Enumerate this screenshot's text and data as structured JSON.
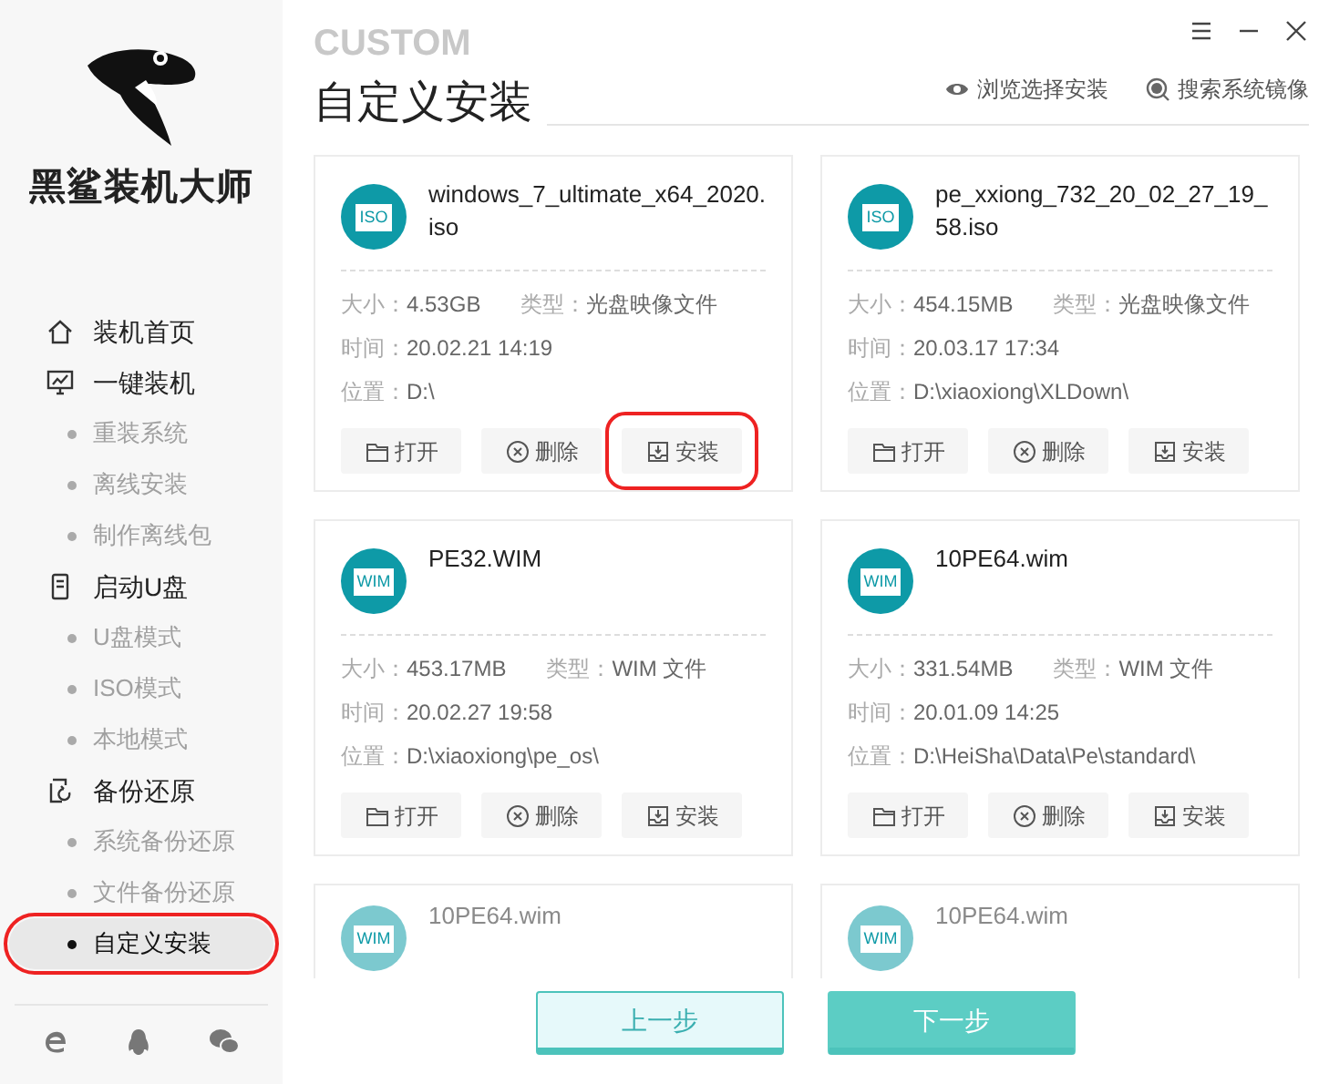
{
  "app": {
    "name": "黑鲨装机大师"
  },
  "nav": [
    {
      "label": "装机首页",
      "kind": "section",
      "selected": false,
      "highlighted": false
    },
    {
      "label": "一键装机",
      "kind": "section",
      "selected": false,
      "highlighted": false
    },
    {
      "label": "重装系统",
      "kind": "sub",
      "selected": false,
      "highlighted": false
    },
    {
      "label": "离线安装",
      "kind": "sub",
      "selected": false,
      "highlighted": false
    },
    {
      "label": "制作离线包",
      "kind": "sub",
      "selected": false,
      "highlighted": false
    },
    {
      "label": "启动U盘",
      "kind": "section",
      "selected": false,
      "highlighted": false
    },
    {
      "label": "U盘模式",
      "kind": "sub",
      "selected": false,
      "highlighted": false
    },
    {
      "label": "ISO模式",
      "kind": "sub",
      "selected": false,
      "highlighted": false
    },
    {
      "label": "本地模式",
      "kind": "sub",
      "selected": false,
      "highlighted": false
    },
    {
      "label": "备份还原",
      "kind": "section",
      "selected": false,
      "highlighted": false
    },
    {
      "label": "系统备份还原",
      "kind": "sub",
      "selected": false,
      "highlighted": false
    },
    {
      "label": "文件备份还原",
      "kind": "sub",
      "selected": false,
      "highlighted": false
    },
    {
      "label": "自定义安装",
      "kind": "sub",
      "selected": true,
      "highlighted": true
    }
  ],
  "page": {
    "title": "自定义安装",
    "title_backdrop": "CUSTOM",
    "actions": [
      {
        "label": "浏览选择安装"
      },
      {
        "label": "搜索系统镜像"
      }
    ]
  },
  "files": [
    {
      "badge": "ISO",
      "name": "windows_7_ultimate_x64_2020.iso",
      "faded": false,
      "size_label": "大小：",
      "size": "4.53GB",
      "type_label": "类型：",
      "type": "光盘映像文件",
      "time_label": "时间：",
      "time": "20.02.21 14:19",
      "location_label": "位置：",
      "location": "D:\\",
      "buttons": [
        {
          "label": "打开",
          "kind": "open",
          "highlighted": false
        },
        {
          "label": "删除",
          "kind": "delete",
          "highlighted": false
        },
        {
          "label": "安装",
          "kind": "install",
          "highlighted": true
        }
      ]
    },
    {
      "badge": "ISO",
      "name": "pe_xxiong_732_20_02_27_19_58.iso",
      "faded": false,
      "size_label": "大小：",
      "size": "454.15MB",
      "type_label": "类型：",
      "type": "光盘映像文件",
      "time_label": "时间：",
      "time": "20.03.17 17:34",
      "location_label": "位置：",
      "location": "D:\\xiaoxiong\\XLDown\\",
      "buttons": [
        {
          "label": "打开",
          "kind": "open",
          "highlighted": false
        },
        {
          "label": "删除",
          "kind": "delete",
          "highlighted": false
        },
        {
          "label": "安装",
          "kind": "install",
          "highlighted": false
        }
      ]
    },
    {
      "badge": "WIM",
      "name": "PE32.WIM",
      "faded": false,
      "size_label": "大小：",
      "size": "453.17MB",
      "type_label": "类型：",
      "type": "WIM 文件",
      "time_label": "时间：",
      "time": "20.02.27 19:58",
      "location_label": "位置：",
      "location": "D:\\xiaoxiong\\pe_os\\",
      "buttons": [
        {
          "label": "打开",
          "kind": "open",
          "highlighted": false
        },
        {
          "label": "删除",
          "kind": "delete",
          "highlighted": false
        },
        {
          "label": "安装",
          "kind": "install",
          "highlighted": false
        }
      ]
    },
    {
      "badge": "WIM",
      "name": "10PE64.wim",
      "faded": false,
      "size_label": "大小：",
      "size": "331.54MB",
      "type_label": "类型：",
      "type": "WIM 文件",
      "time_label": "时间：",
      "time": "20.01.09 14:25",
      "location_label": "位置：",
      "location": "D:\\HeiSha\\Data\\Pe\\standard\\",
      "buttons": [
        {
          "label": "打开",
          "kind": "open",
          "highlighted": false
        },
        {
          "label": "删除",
          "kind": "delete",
          "highlighted": false
        },
        {
          "label": "安装",
          "kind": "install",
          "highlighted": false
        }
      ]
    },
    {
      "badge": "WIM",
      "name": "10PE64.wim",
      "faded": true
    },
    {
      "badge": "WIM",
      "name": "10PE64.wim",
      "faded": true
    }
  ],
  "footer": [
    {
      "label": "上一步",
      "kind": "secondary"
    },
    {
      "label": "下一步",
      "kind": "primary"
    }
  ]
}
